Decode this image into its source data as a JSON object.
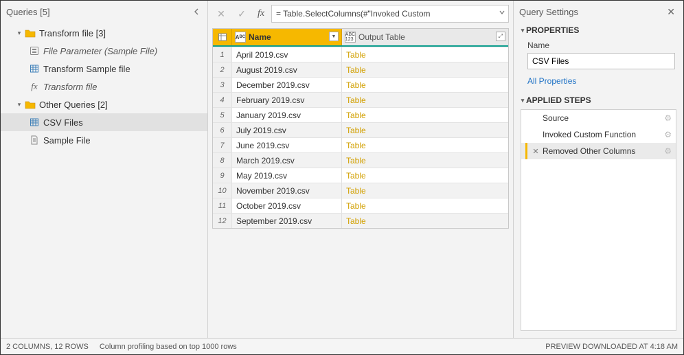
{
  "queries_panel": {
    "title": "Queries [5]",
    "groups": [
      {
        "label": "Transform file [3]"
      },
      {
        "label": "Other Queries [2]"
      }
    ],
    "items_g1": [
      {
        "label": "File Parameter (Sample File)",
        "italic": true,
        "icon": "param"
      },
      {
        "label": "Transform Sample file",
        "italic": false,
        "icon": "table"
      },
      {
        "label": "Transform file",
        "italic": true,
        "icon": "fx"
      }
    ],
    "items_g2": [
      {
        "label": "CSV Files",
        "selected": true,
        "icon": "table"
      },
      {
        "label": "Sample File",
        "icon": "doc"
      }
    ]
  },
  "formula": {
    "text": "= Table.SelectColumns(#\"Invoked Custom"
  },
  "table": {
    "col1_header": "Name",
    "col2_header": "Output Table",
    "rows": [
      {
        "name": "April 2019.csv",
        "out": "Table"
      },
      {
        "name": "August 2019.csv",
        "out": "Table"
      },
      {
        "name": "December 2019.csv",
        "out": "Table"
      },
      {
        "name": "February 2019.csv",
        "out": "Table"
      },
      {
        "name": "January 2019.csv",
        "out": "Table"
      },
      {
        "name": "July 2019.csv",
        "out": "Table"
      },
      {
        "name": "June 2019.csv",
        "out": "Table"
      },
      {
        "name": "March 2019.csv",
        "out": "Table"
      },
      {
        "name": "May 2019.csv",
        "out": "Table"
      },
      {
        "name": "November 2019.csv",
        "out": "Table"
      },
      {
        "name": "October 2019.csv",
        "out": "Table"
      },
      {
        "name": "September 2019.csv",
        "out": "Table"
      }
    ]
  },
  "settings": {
    "title": "Query Settings",
    "properties_label": "PROPERTIES",
    "name_label": "Name",
    "name_value": "CSV Files",
    "all_properties": "All Properties",
    "applied_steps_label": "APPLIED STEPS",
    "steps": [
      {
        "label": "Source",
        "gear": true
      },
      {
        "label": "Invoked Custom Function",
        "gear": true
      },
      {
        "label": "Removed Other Columns",
        "gear": true,
        "selected": true,
        "x": true
      }
    ]
  },
  "status": {
    "cols_rows": "2 COLUMNS, 12 ROWS",
    "profiling": "Column profiling based on top 1000 rows",
    "preview": "PREVIEW DOWNLOADED AT 4:18 AM"
  }
}
